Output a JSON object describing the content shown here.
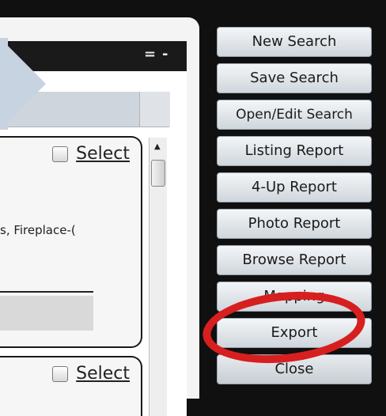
{
  "window": {
    "menu_glyph": "=",
    "minimize_glyph": "-"
  },
  "listings": [
    {
      "select_label": "Select",
      "description": "s, Fireplace-("
    },
    {
      "select_label": "Select"
    }
  ],
  "scrollbar": {
    "up_arrow": "▲"
  },
  "sidebar": {
    "buttons": [
      {
        "label": "New Search"
      },
      {
        "label": "Save Search"
      },
      {
        "label": "Open/Edit Search"
      },
      {
        "label": "Listing Report"
      },
      {
        "label": "4-Up Report"
      },
      {
        "label": "Photo Report"
      },
      {
        "label": "Browse Report"
      },
      {
        "label": "Mapping"
      },
      {
        "label": "Export"
      },
      {
        "label": "Close"
      }
    ]
  },
  "colors": {
    "highlight": "#d71f1f",
    "background": "#101010"
  }
}
